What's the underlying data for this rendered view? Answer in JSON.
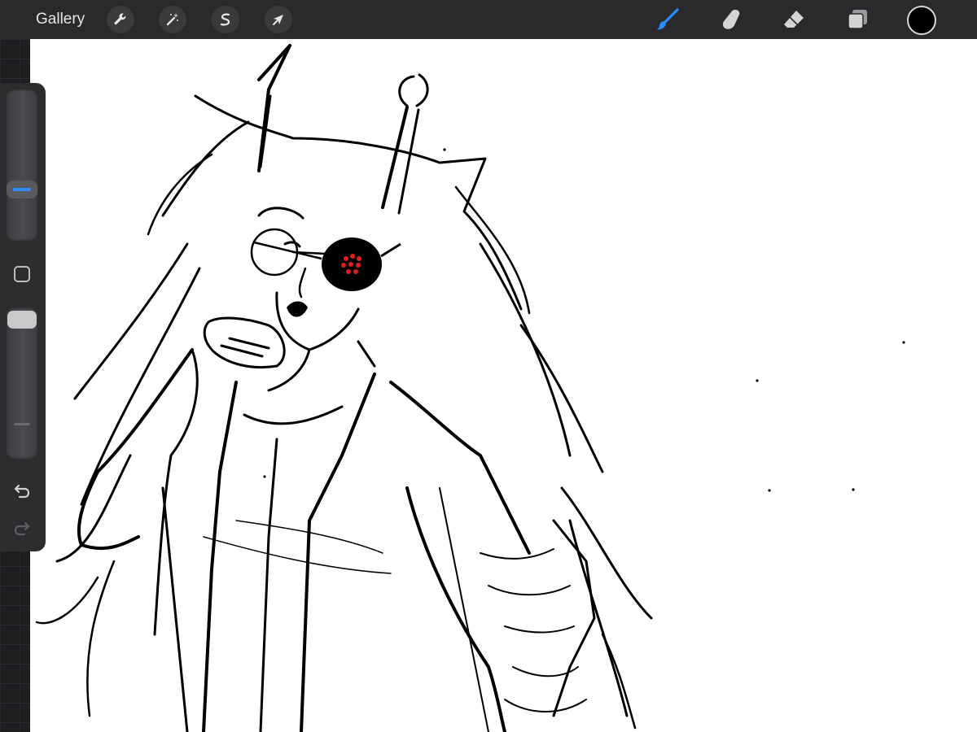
{
  "toolbar": {
    "gallery_label": "Gallery",
    "left_tools": [
      {
        "name": "actions",
        "icon": "wrench-icon"
      },
      {
        "name": "adjustments",
        "icon": "magic-wand-icon"
      },
      {
        "name": "selection",
        "icon": "selection-s-icon"
      },
      {
        "name": "transform",
        "icon": "arrow-cursor-icon"
      }
    ],
    "right_tools": [
      {
        "name": "brush",
        "icon": "brush-icon",
        "active": true
      },
      {
        "name": "smudge",
        "icon": "smudge-finger-icon",
        "active": false
      },
      {
        "name": "eraser",
        "icon": "eraser-icon",
        "active": false
      },
      {
        "name": "layers",
        "icon": "layers-icon",
        "active": false
      }
    ],
    "color": "#000000"
  },
  "sidebar": {
    "brush_size_level": 0.35,
    "opacity_level": 1.0
  },
  "colors": {
    "accent": "#2f8cff",
    "ink": "#000000",
    "eye_dots": "#e02020"
  }
}
